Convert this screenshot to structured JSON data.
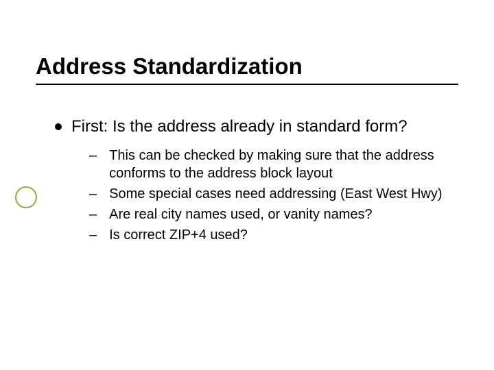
{
  "title": "Address Standardization",
  "main_point": "First: Is the address already in standard form?",
  "sub": {
    "a": "This can be checked by making sure that the address conforms to the address block layout",
    "b": "Some special cases need addressing (East West Hwy)",
    "c": "Are real city names used, or vanity names?",
    "d": "Is correct ZIP+4 used?"
  }
}
